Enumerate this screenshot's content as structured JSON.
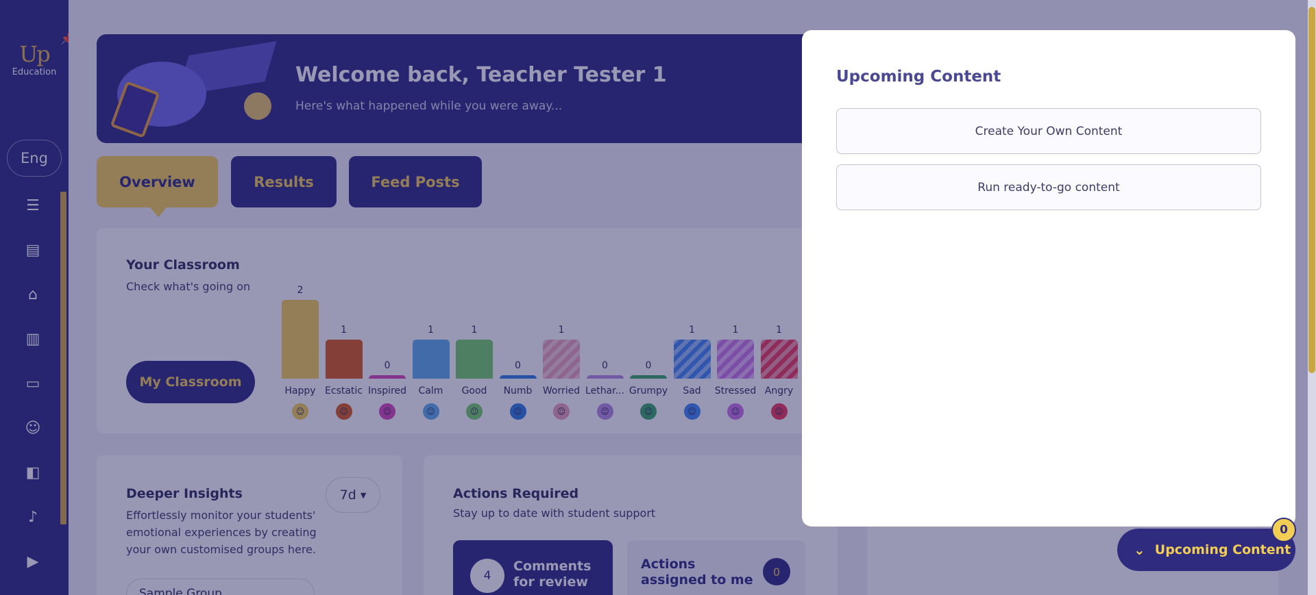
{
  "sidebar": {
    "logo_mark": "Up",
    "logo_text": "Education",
    "pin_icon": "pin-icon",
    "language": "Eng",
    "nav_icons": [
      "dashboard-icon",
      "journal-icon",
      "graduation-cap-icon",
      "chart-icon",
      "chat-icon",
      "users-icon",
      "book-icon",
      "bell-icon",
      "play-icon"
    ]
  },
  "banner": {
    "title": "Welcome back, Teacher Tester 1",
    "subtitle": "Here's what happened while you were away..."
  },
  "tabs": [
    {
      "label": "Overview",
      "active": true
    },
    {
      "label": "Results",
      "active": false
    },
    {
      "label": "Feed Posts",
      "active": false
    }
  ],
  "classroom": {
    "title": "Your Classroom",
    "subtitle": "Check what's going on",
    "button": "My Classroom"
  },
  "chart_data": {
    "type": "bar",
    "categories": [
      "Happy",
      "Ecstatic",
      "Inspired",
      "Calm",
      "Good",
      "Numb",
      "Worried",
      "Lethar...",
      "Grumpy",
      "Sad",
      "Stressed",
      "Angry"
    ],
    "values": [
      2,
      1,
      0,
      1,
      1,
      0,
      1,
      0,
      0,
      1,
      1,
      1
    ],
    "colors": [
      "#f3ce55",
      "#d65c1c",
      "#d54ab6",
      "#5faee9",
      "#77d06b",
      "#2f7fe0",
      "#e9a1b5",
      "#b58ae0",
      "#39a766",
      "#3f86f0",
      "#c775e6",
      "#ec3b5a"
    ],
    "striped": [
      false,
      false,
      false,
      false,
      false,
      false,
      true,
      false,
      false,
      true,
      true,
      true
    ],
    "title": "",
    "xlabel": "",
    "ylabel": "",
    "ylim": [
      0,
      2
    ]
  },
  "insights": {
    "title": "Deeper Insights",
    "subtitle": "Effortlessly monitor your students' emotional experiences by creating your own customised groups here.",
    "range": "7d",
    "group": "Sample Group"
  },
  "actions": {
    "title": "Actions Required",
    "subtitle": "Stay up to date with student support",
    "comments_count": "4",
    "comments_label": "Comments for review",
    "assigned_label": "Actions assigned to me",
    "assigned_count": "0"
  },
  "modal": {
    "title": "Upcoming Content",
    "create_label": "Create Your Own Content",
    "run_label": "Run ready-to-go content"
  },
  "floating": {
    "label": "Upcoming Content",
    "badge": "0"
  }
}
